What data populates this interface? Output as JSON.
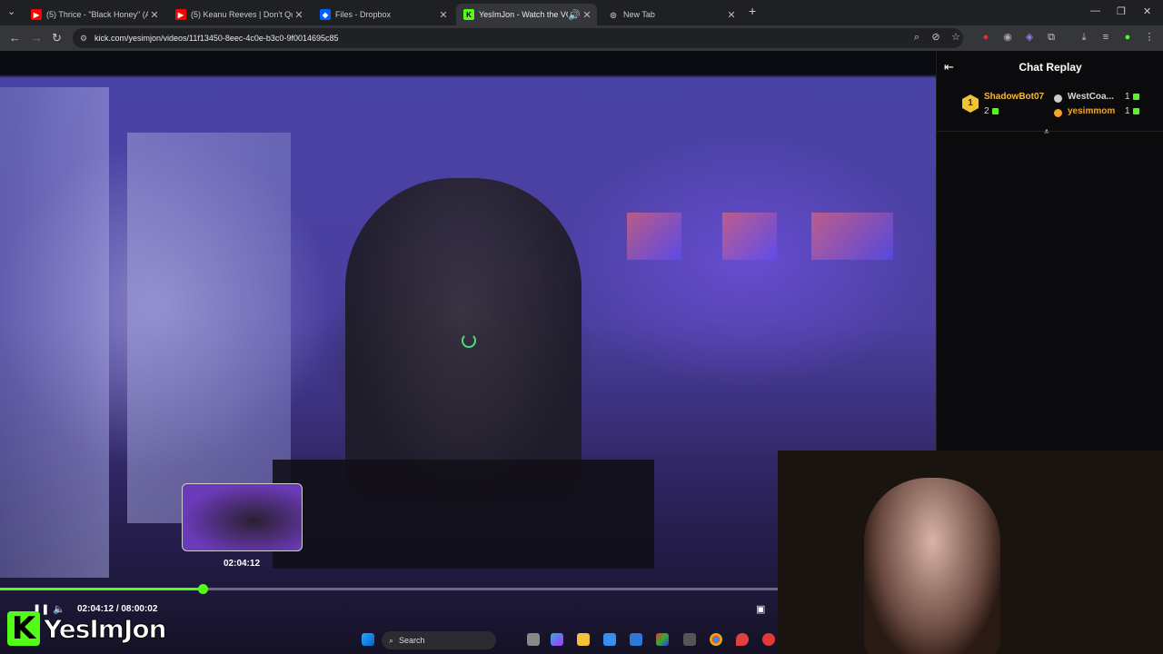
{
  "browser": {
    "tabs": [
      {
        "title": "(5) Thrice - \"Black Honey\" (Acou",
        "favicon": "youtube-icon",
        "active": false
      },
      {
        "title": "(5) Keanu Reeves | Don't Quit Yo",
        "favicon": "youtube-icon",
        "active": false
      },
      {
        "title": "Files - Dropbox",
        "favicon": "dropbox-icon",
        "active": false
      },
      {
        "title": "YesImJon - Watch the VOD",
        "favicon": "kick-icon",
        "active": true
      },
      {
        "title": "New Tab",
        "favicon": "globe-icon",
        "active": false
      }
    ],
    "new_tab_glyph": "+",
    "url": "kick.com/yesimjon/videos/11f13450-8eec-4c0e-b3c0-9f0014695c85"
  },
  "player": {
    "hover_time": "02:04:12",
    "current_time": "02:04:12",
    "separator": "/",
    "duration": "08:00:02",
    "progress_fraction": 0.26,
    "accent": "#53fc18"
  },
  "channel": {
    "logo_letter": "K",
    "name": "YesImJon"
  },
  "chat": {
    "title": "Chat Replay",
    "leaderboard": [
      {
        "rank": "1",
        "name": "ShadowBot07",
        "count": "2",
        "color": "#f5b940"
      },
      {
        "name": "WestCoa...",
        "count": "1",
        "color": "#d6d6d6"
      },
      {
        "name": "yesimmom",
        "count": "1",
        "color": "#f5a623"
      }
    ]
  },
  "taskbar": {
    "search_label": "Search"
  }
}
